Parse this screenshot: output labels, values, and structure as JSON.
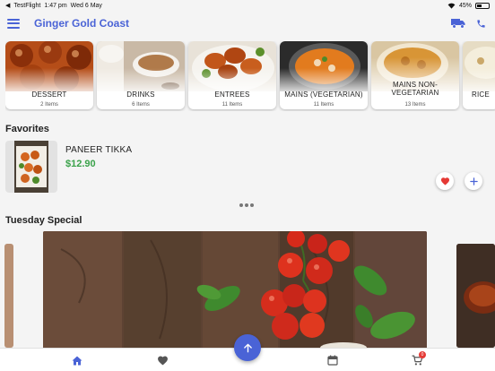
{
  "status_bar": {
    "back_app": "TestFlight",
    "time": "1:47 pm",
    "date": "Wed 6 May",
    "battery": "45%",
    "battery_level": 0.45
  },
  "header": {
    "title": "Ginger Gold Coast",
    "icons": [
      "menu-icon",
      "truck-icon",
      "phone-icon"
    ]
  },
  "categories": [
    {
      "name": "DESSERT",
      "count": "2 Items"
    },
    {
      "name": "DRINKS",
      "count": "6 Items"
    },
    {
      "name": "ENTREES",
      "count": "11 Items"
    },
    {
      "name": "MAINS (VEGETARIAN)",
      "count": "11 Items"
    },
    {
      "name": "MAINS NON-VEGETARIAN",
      "count": "13 Items"
    },
    {
      "name": "RICE",
      "count": ""
    }
  ],
  "favorites": {
    "title": "Favorites",
    "items": [
      {
        "name": "PANEER TIKKA",
        "price": "$12.90"
      }
    ]
  },
  "special": {
    "title": "Tuesday Special"
  },
  "bottom_nav": {
    "items": [
      "home-icon",
      "heart-icon",
      "arrow-up-icon",
      "calendar-icon",
      "cart-icon"
    ],
    "cart_count": "0"
  },
  "colors": {
    "accent": "#4a63d6",
    "price": "#3aa24a",
    "favorite": "#e53935"
  }
}
